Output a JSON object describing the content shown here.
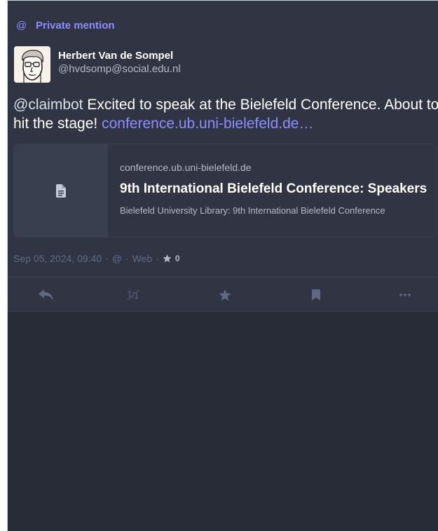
{
  "prepend": {
    "icon": "at-icon",
    "at_glyph": "@",
    "label": "Private mention",
    "color": "#8c8dff"
  },
  "author": {
    "display_name": "Herbert Van de Sompel",
    "acct": "@hvdsomp@social.edu.nl"
  },
  "content": {
    "mention": "@claimbot",
    "text": " Excited to speak at the Bielefeld Conference. About to hit the stage! ",
    "link": "conference.ub.uni-bielefeld.de…"
  },
  "card": {
    "icon": "file-icon",
    "host": "conference.ub.uni-bielefeld.de",
    "title": "9th International Bielefeld Conference: Speakers",
    "description": "Bielefeld University Library: 9th International Bielefeld Conference"
  },
  "meta": {
    "timestamp": "Sep 05, 2024, 09:40",
    "sep1": " · ",
    "visibility": "@",
    "sep2": " · ",
    "application": "Web",
    "sep3": " · ",
    "favourites_count": "0"
  },
  "actions": [
    {
      "name": "reply-icon"
    },
    {
      "name": "boost-disabled-icon"
    },
    {
      "name": "star-icon"
    },
    {
      "name": "bookmark-icon"
    },
    {
      "name": "ellipsis-icon"
    }
  ],
  "colors": {
    "background": "#282c37",
    "status_background": "#313543",
    "accent": "#8c8dff",
    "muted": "#606984",
    "secondary": "#b4b8c9"
  }
}
